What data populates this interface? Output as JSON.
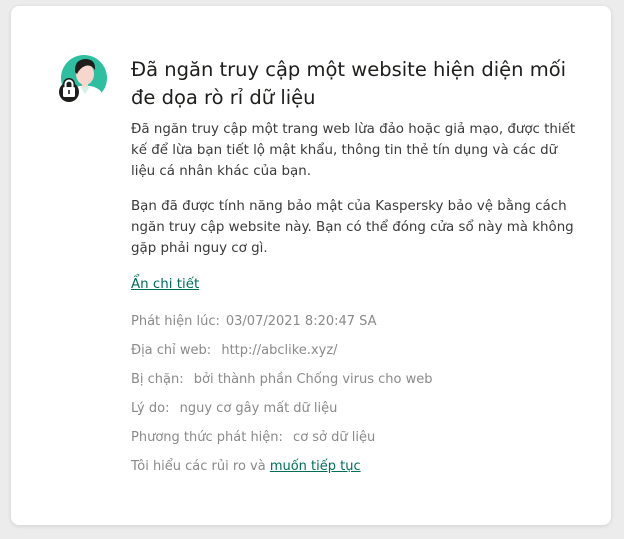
{
  "dialog": {
    "title": "Đã ngăn truy cập một website hiện diện mối đe dọa rò rỉ dữ liệu",
    "paragraph1": "Đã ngăn truy cập một trang web lừa đảo hoặc giả mạo, được thiết kế để lừa bạn tiết lộ mật khẩu, thông tin thẻ tín dụng và các dữ liệu cá nhân khác của bạn.",
    "paragraph2": "Bạn đã được tính năng bảo mật của Kaspersky bảo vệ bằng cách ngăn truy cập website này. Bạn có thể đóng cửa sổ này mà không gặp phải nguy cơ gì.",
    "hide_details_label": "Ẩn chi tiết",
    "icon": "user-lock-icon",
    "accent_color": "#2fbfa0",
    "link_color": "#006d5b"
  },
  "details": {
    "detected_label": "Phát hiện lúc:",
    "detected_value": "03/07/2021 8:20:47 SA",
    "address_label": "Địa chỉ web:",
    "address_value": "http://abclike.xyz/",
    "blocked_label": "Bị chặn:",
    "blocked_value": "bởi thành phần Chống virus cho web",
    "reason_label": "Lý do:",
    "reason_value": "nguy cơ gây mất dữ liệu",
    "method_label": "Phương thức phát hiện:",
    "method_value": "cơ sở dữ liệu",
    "risk_text": "Tôi hiểu các rủi ro và",
    "continue_link": "muốn tiếp tục"
  }
}
